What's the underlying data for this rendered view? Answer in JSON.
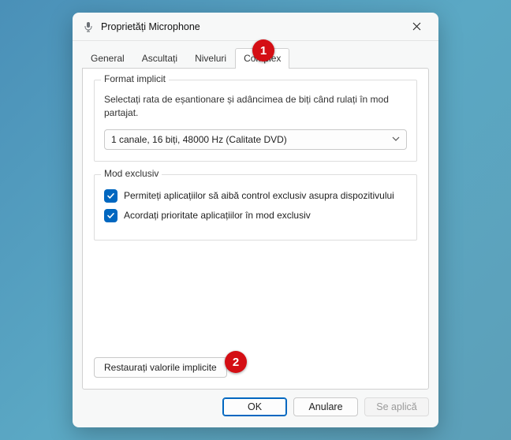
{
  "window": {
    "title": "Proprietăți Microphone"
  },
  "tabs": [
    {
      "label": "General"
    },
    {
      "label": "Ascultați"
    },
    {
      "label": "Niveluri"
    },
    {
      "label": "Complex"
    }
  ],
  "format_group": {
    "title": "Format implicit",
    "description": "Selectați rata de eșantionare și adâncimea de biți când rulați în mod partajat.",
    "selected": "1 canale, 16 biți, 48000 Hz (Calitate DVD)"
  },
  "exclusive_group": {
    "title": "Mod exclusiv",
    "option1": "Permiteți aplicațiilor să aibă control exclusiv asupra dispozitivului",
    "option2": "Acordați prioritate aplicațiilor în mod exclusiv"
  },
  "restore_label": "Restaurați valorile implicite",
  "footer": {
    "ok": "OK",
    "cancel": "Anulare",
    "apply": "Se aplică"
  },
  "annotations": {
    "one": "1",
    "two": "2"
  }
}
